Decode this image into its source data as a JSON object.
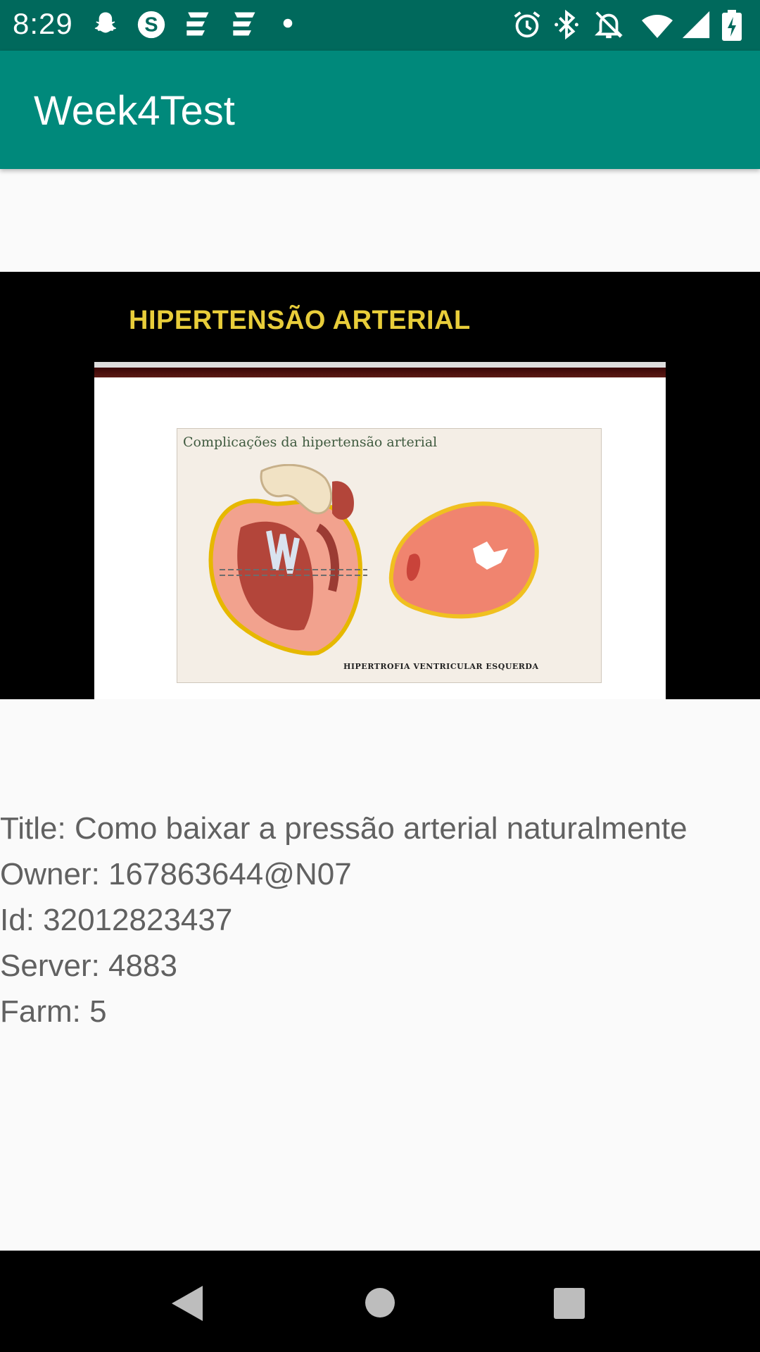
{
  "status_bar": {
    "time": "8:29",
    "left_icons": [
      "snapchat-icon",
      "skype-icon",
      "news-icon",
      "news-icon",
      "dot-icon"
    ],
    "right_icons": [
      "alarm-icon",
      "bluetooth-icon",
      "notifications-off-icon",
      "wifi-icon",
      "signal-icon",
      "battery-charging-icon"
    ]
  },
  "app_bar": {
    "title": "Week4Test"
  },
  "photo": {
    "heading": "HIPERTENSÃO ARTERIAL",
    "caption": "Complicações da hipertensão arterial",
    "label": "HIPERTROFIA VENTRICULAR ESQUERDA"
  },
  "details": {
    "title": "Title: Como baixar a pressão arterial naturalmente",
    "owner": "Owner: 167863644@N07",
    "id": "Id: 32012823437",
    "server": "Server: 4883",
    "farm": "Farm: 5"
  },
  "nav_bar": {
    "icons": [
      "back-icon",
      "home-icon",
      "recents-icon"
    ]
  },
  "colors": {
    "status_bar": "#00695c",
    "app_bar": "#00897b",
    "text": "#616161"
  }
}
